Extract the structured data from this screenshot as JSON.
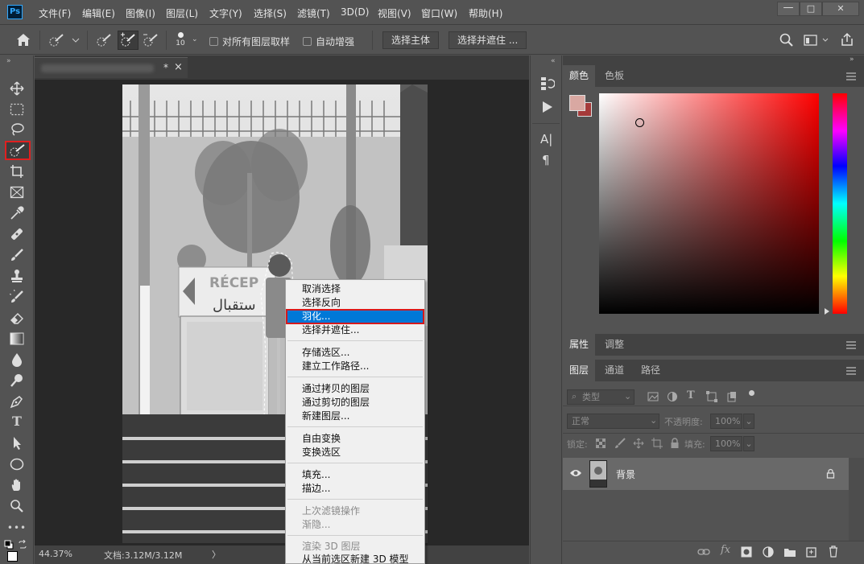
{
  "app": {
    "logo": "Ps"
  },
  "menu": [
    "文件(F)",
    "编辑(E)",
    "图像(I)",
    "图层(L)",
    "文字(Y)",
    "选择(S)",
    "滤镜(T)",
    "3D(D)",
    "视图(V)",
    "窗口(W)",
    "帮助(H)"
  ],
  "window_controls": {
    "restore": "☐",
    "minimize": "—",
    "maximize": "□",
    "close": "✕"
  },
  "options": {
    "brush_size": "10",
    "sample_all_layers": "对所有图层取样",
    "auto_enhance": "自动增强",
    "select_subject": "选择主体",
    "select_and_mask": "选择并遮住 ..."
  },
  "doc": {
    "tab_modified": "*",
    "tab_close": "×"
  },
  "status": {
    "zoom": "44.37%",
    "doc_size": "文档:3.12M/3.12M",
    "arrow": "〉"
  },
  "canvas": {
    "sign_text": "RÉCEP",
    "sign_arabic": "ستقبال"
  },
  "context_menu": [
    {
      "label": "取消选择",
      "disabled": false
    },
    {
      "label": "选择反向",
      "disabled": false
    },
    {
      "label": "羽化...",
      "disabled": false,
      "highlighted": true
    },
    {
      "label": "选择并遮住...",
      "disabled": false
    },
    {
      "label": "存储选区...",
      "disabled": false
    },
    {
      "label": "建立工作路径...",
      "disabled": false
    },
    {
      "label": "通过拷贝的图层",
      "disabled": false
    },
    {
      "label": "通过剪切的图层",
      "disabled": false
    },
    {
      "label": "新建图层...",
      "disabled": false
    },
    {
      "label": "自由变换",
      "disabled": false
    },
    {
      "label": "变换选区",
      "disabled": false
    },
    {
      "label": "填充...",
      "disabled": false
    },
    {
      "label": "描边...",
      "disabled": false
    },
    {
      "label": "上次滤镜操作",
      "disabled": true
    },
    {
      "label": "渐隐...",
      "disabled": true
    },
    {
      "label": "渲染 3D 图层",
      "disabled": true
    },
    {
      "label": "从当前选区新建 3D 模型",
      "disabled": false
    }
  ],
  "color_panel": {
    "tabs": [
      "颜色",
      "色板"
    ],
    "foreground": "#d9a8a2",
    "background": "#a53a3a"
  },
  "properties_panel": {
    "tabs": [
      "属性",
      "调整"
    ]
  },
  "layers_panel": {
    "tabs": [
      "图层",
      "通道",
      "路径"
    ],
    "filter_kind": "类型",
    "blend_mode": "正常",
    "opacity_label": "不透明度:",
    "opacity_value": "100%",
    "lock_label": "锁定:",
    "fill_label": "填充:",
    "fill_value": "100%",
    "layers": [
      {
        "name": "背景",
        "visible": true,
        "locked": true
      }
    ]
  },
  "side_strip": {
    "char_icon": "A|",
    "para_icon": "¶"
  },
  "colors": {
    "accent": "#0078d7",
    "highlight_box": "#d7191c"
  }
}
